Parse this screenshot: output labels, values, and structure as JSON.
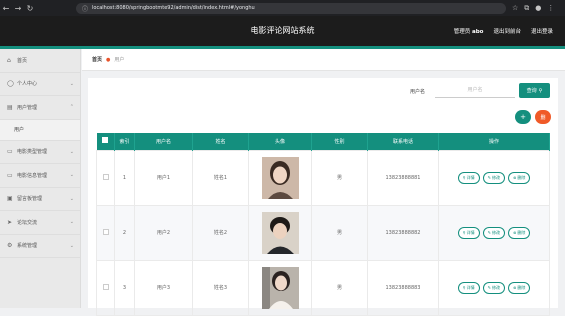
{
  "browser": {
    "url": "localhost:8080/springbootmte92/admin/dist/index.html#/yonghu"
  },
  "app": {
    "title": "电影评论网站系统",
    "user_prefix": "管理员",
    "username": "abo",
    "back_label": "退出到前台",
    "logout_label": "退出登录"
  },
  "sidebar": {
    "items": [
      {
        "label": "首页",
        "icon": "home-icon"
      },
      {
        "label": "个人中心",
        "icon": "user-icon"
      },
      {
        "label": "用户管理",
        "icon": "users-icon"
      },
      {
        "label": "电影类型管理",
        "icon": "film-icon"
      },
      {
        "label": "电影信息管理",
        "icon": "film-icon"
      },
      {
        "label": "留言板管理",
        "icon": "message-icon"
      },
      {
        "label": "论坛交流",
        "icon": "send-icon"
      },
      {
        "label": "系统管理",
        "icon": "gear-icon"
      }
    ],
    "sub_item": "用户"
  },
  "breadcrumb": {
    "home": "首页",
    "current": "用户"
  },
  "search": {
    "label": "用户名",
    "placeholder": "用户名",
    "button": "查询"
  },
  "actions": {
    "add": "+",
    "delete": "删"
  },
  "table": {
    "headers": [
      "索引",
      "用户名",
      "姓名",
      "头像",
      "性别",
      "联系电话",
      "操作"
    ],
    "rows": [
      {
        "index": "1",
        "username": "用户1",
        "name": "姓名1",
        "gender": "男",
        "phone": "13823888881"
      },
      {
        "index": "2",
        "username": "用户2",
        "name": "姓名2",
        "gender": "男",
        "phone": "13823888882"
      },
      {
        "index": "3",
        "username": "用户3",
        "name": "姓名3",
        "gender": "男",
        "phone": "13823888883"
      }
    ],
    "ops": {
      "detail": "详情",
      "edit": "修改",
      "delete": "删除"
    }
  },
  "colors": {
    "accent": "#148f7e",
    "danger": "#f05a28",
    "header_bg": "#1c1c1c"
  }
}
